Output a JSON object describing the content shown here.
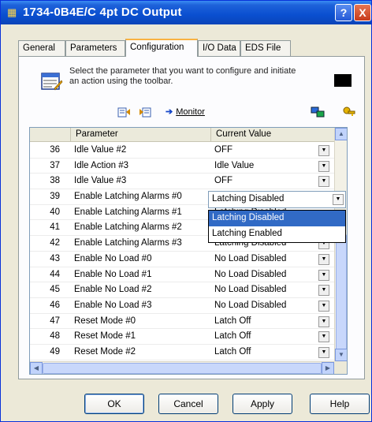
{
  "window": {
    "title": "1734-0B4E/C 4pt DC Output"
  },
  "titlebar_buttons": {
    "help": "?",
    "close": "X"
  },
  "tabs": [
    {
      "label": "General",
      "active": false
    },
    {
      "label": "Parameters",
      "active": false
    },
    {
      "label": "Configuration",
      "active": true
    },
    {
      "label": "I/O Data",
      "active": false
    },
    {
      "label": "EDS File",
      "active": false
    }
  ],
  "hint": {
    "text": "Select the parameter that you want to configure and initiate an action using the toolbar."
  },
  "toolbar": {
    "monitor_label": "Monitor"
  },
  "grid": {
    "columns": [
      "Parameter",
      "Current Value"
    ],
    "rows": [
      {
        "num": "36",
        "param": "Idle Value #2",
        "value": "OFF"
      },
      {
        "num": "37",
        "param": "Idle Action #3",
        "value": "Idle Value"
      },
      {
        "num": "38",
        "param": "Idle Value #3",
        "value": "OFF"
      },
      {
        "num": "39",
        "param": "Enable Latching Alarms #0",
        "value": "Latching Disabled"
      },
      {
        "num": "40",
        "param": "Enable Latching Alarms #1",
        "value": "Latching Disabled"
      },
      {
        "num": "41",
        "param": "Enable Latching Alarms #2",
        "value": "Latching Enabled"
      },
      {
        "num": "42",
        "param": "Enable Latching Alarms #3",
        "value": "Latching Disabled"
      },
      {
        "num": "43",
        "param": "Enable No Load #0",
        "value": "No Load Disabled"
      },
      {
        "num": "44",
        "param": "Enable No Load #1",
        "value": "No Load Disabled"
      },
      {
        "num": "45",
        "param": "Enable No Load #2",
        "value": "No Load Disabled"
      },
      {
        "num": "46",
        "param": "Enable No Load #3",
        "value": "No Load Disabled"
      },
      {
        "num": "47",
        "param": "Reset Mode #0",
        "value": "Latch Off"
      },
      {
        "num": "48",
        "param": "Reset Mode #1",
        "value": "Latch Off"
      },
      {
        "num": "49",
        "param": "Reset Mode #2",
        "value": "Latch Off"
      }
    ],
    "editing_value": "Latching Disabled",
    "dropdown_options": [
      "Latching Disabled",
      "Latching Enabled"
    ]
  },
  "buttons": {
    "ok": "OK",
    "cancel": "Cancel",
    "apply": "Apply",
    "help": "Help"
  },
  "colors": {
    "title_bar": "#0A4FD0",
    "selection": "#316AC5",
    "active_tab_accent": "#F9B242"
  }
}
